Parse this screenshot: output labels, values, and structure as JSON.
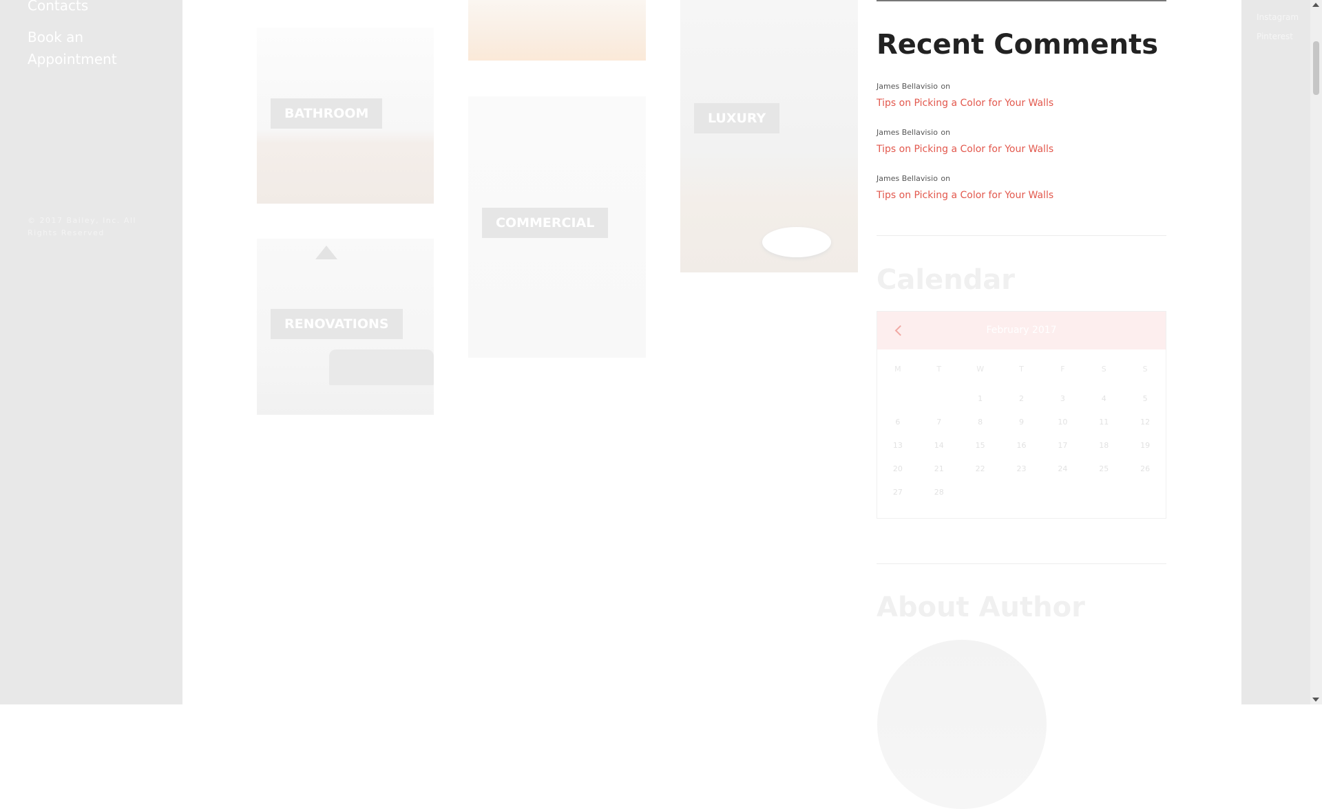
{
  "sidebar": {
    "contacts": "Contacts",
    "book": "Book an Appointment",
    "copyright": "© 2017 Bailey, Inc. All Rights Reserved"
  },
  "social": [
    "Instagram",
    "Pinterest"
  ],
  "tiles": {
    "bathroom": "BATHROOM",
    "renovations": "RENOVATIONS",
    "commercial": "COMMERCIAL",
    "luxury": "LUXURY"
  },
  "recent_comments": {
    "title": "Recent Comments",
    "items": [
      {
        "author": "James Bellavisio",
        "connector": "on",
        "post": "Tips on Picking a Color for Your Walls"
      },
      {
        "author": "James Bellavisio",
        "connector": "on",
        "post": "Tips on Picking a Color for Your Walls"
      },
      {
        "author": "James Bellavisio",
        "connector": "on",
        "post": "Tips on Picking a Color for Your Walls"
      }
    ]
  },
  "calendar": {
    "title": "Calendar",
    "month": "February 2017",
    "weekdays": [
      "M",
      "T",
      "W",
      "T",
      "F",
      "S",
      "S"
    ],
    "weeks": [
      [
        "",
        "",
        "1",
        "2",
        "3",
        "4",
        "5"
      ],
      [
        "6",
        "7",
        "8",
        "9",
        "10",
        "11",
        "12"
      ],
      [
        "13",
        "14",
        "15",
        "16",
        "17",
        "18",
        "19"
      ],
      [
        "20",
        "21",
        "22",
        "23",
        "24",
        "25",
        "26"
      ],
      [
        "27",
        "28",
        "",
        "",
        "",
        "",
        ""
      ]
    ]
  },
  "about": {
    "title": "About Author"
  },
  "colors": {
    "accent": "#e2574c",
    "heading": "#222222",
    "sidebar_bg": "#e8e8e8"
  }
}
